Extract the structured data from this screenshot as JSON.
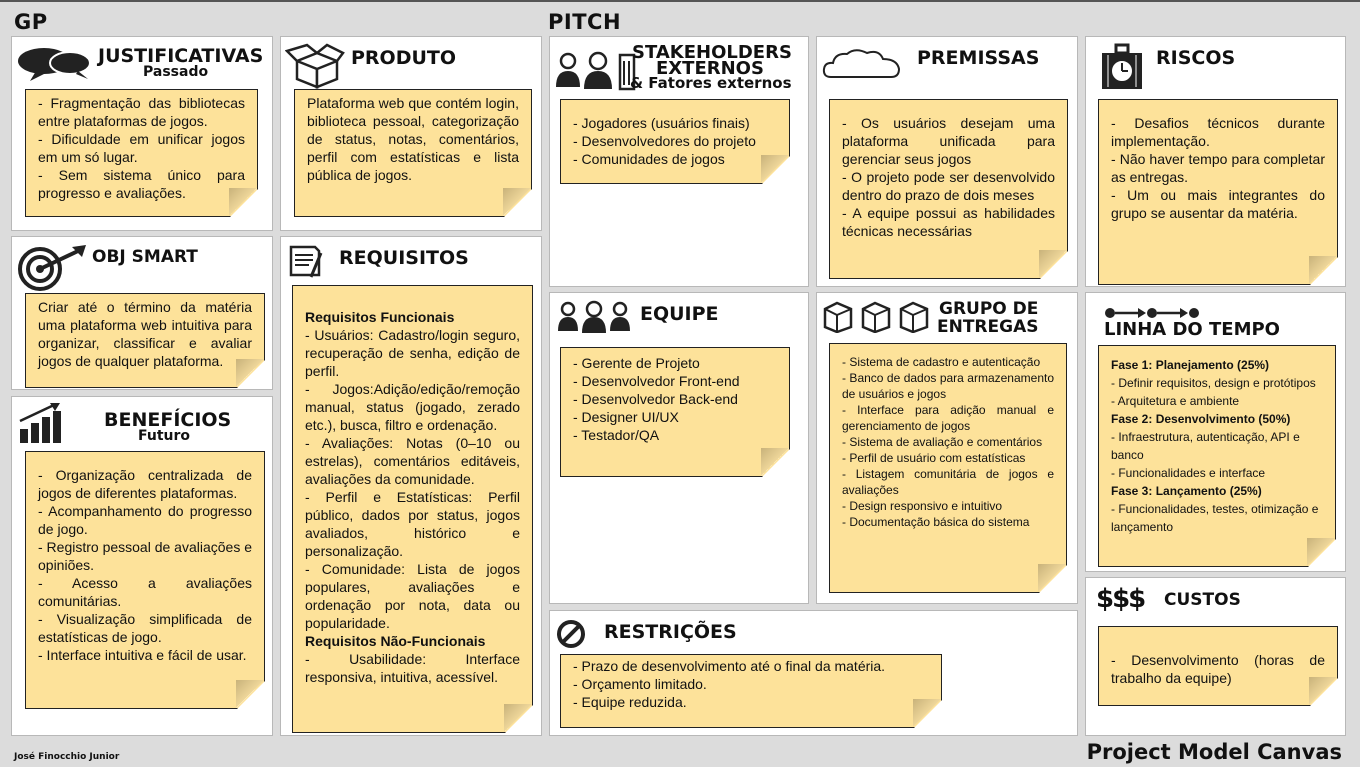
{
  "headers": {
    "gp": "GP",
    "pitch": "PITCH"
  },
  "justificativas": {
    "title": "JUSTIFICATIVAS",
    "subtitle": "Passado",
    "items": [
      "- Fragmentação das bibliotecas entre plataformas de jogos.",
      "- Dificuldade em unificar jogos em um só lugar.",
      "- Sem sistema único para progresso e avaliações."
    ]
  },
  "produto": {
    "title": "PRODUTO",
    "text": "Plataforma web que contém login, biblioteca pessoal, categorização de status, notas, comentários, perfil com estatísticas e lista pública de jogos."
  },
  "stakeholders": {
    "title1": "STAKEHOLDERS",
    "title2": "EXTERNOS",
    "title3": "& Fatores externos",
    "items": [
      "- Jogadores (usuários finais)",
      "- Desenvolvedores do projeto",
      "- Comunidades de jogos"
    ]
  },
  "premissas": {
    "title": "PREMISSAS",
    "items": [
      "- Os usuários desejam uma plataforma unificada para gerenciar seus jogos",
      "- O projeto pode ser desenvolvido dentro do prazo de dois meses",
      "- A equipe possui as habilidades técnicas necessárias"
    ]
  },
  "riscos": {
    "title": "RISCOS",
    "items": [
      "- Desafios técnicos durante implementação.",
      "- Não haver tempo para completar as entregas.",
      "- Um ou mais integrantes do grupo se ausentar da matéria."
    ]
  },
  "obj": {
    "title": "OBJ SMART",
    "text": "Criar até o término da matéria uma plataforma web intuitiva para organizar, classificar e avaliar jogos de qualquer plataforma."
  },
  "requisitos": {
    "title": "REQUISITOS",
    "funcionais_title": "Requisitos Funcionais",
    "funcionais": [
      "- Usuários: Cadastro/login seguro, recuperação de senha, edição de perfil.",
      "- Jogos:Adição/edição/remoção manual, status (jogado, zerado etc.), busca, filtro e ordenação.",
      "- Avaliações: Notas (0–10 ou estrelas), comentários editáveis, avaliações da comunidade.",
      "- Perfil e Estatísticas: Perfil público, dados por status, jogos avaliados, histórico e personalização.",
      "- Comunidade: Lista de jogos populares, avaliações e ordenação por nota, data ou popularidade."
    ],
    "nao_funcionais_title": "Requisitos Não-Funcionais",
    "nao_funcionais": [
      "- Usabilidade: Interface responsiva, intuitiva, acessível."
    ]
  },
  "equipe": {
    "title": "EQUIPE",
    "items": [
      "- Gerente de Projeto",
      "- Desenvolvedor Front-end",
      "- Desenvolvedor Back-end",
      "- Designer UI/UX",
      "- Testador/QA"
    ]
  },
  "entregas": {
    "title1": "GRUPO DE",
    "title2": "ENTREGAS",
    "items": [
      "- Sistema de cadastro e autenticação",
      "- Banco de dados para armazenamento de usuários e jogos",
      "- Interface para adição manual e gerenciamento de jogos",
      "- Sistema de avaliação e comentários",
      "- Perfil de usuário com estatísticas",
      "- Listagem comunitária de jogos e avaliações",
      "- Design responsivo e intuitivo",
      "- Documentação básica do sistema"
    ]
  },
  "linha": {
    "title": "LINHA DO TEMPO",
    "fase1": "Fase 1: Planejamento (25%)",
    "fase1_items": [
      "- Definir requisitos, design e protótipos",
      "- Arquitetura e ambiente"
    ],
    "fase2": "Fase 2: Desenvolvimento (50%)",
    "fase2_items": [
      "- Infraestrutura, autenticação, API e banco",
      "- Funcionalidades e interface"
    ],
    "fase3": "Fase 3: Lançamento (25%)",
    "fase3_items": [
      "- Funcionalidades, testes, otimização e lançamento"
    ]
  },
  "beneficios": {
    "title": "BENEFÍCIOS",
    "subtitle": "Futuro",
    "items": [
      "- Organização centralizada de jogos de diferentes plataformas.",
      "- Acompanhamento do progresso de jogo.",
      "- Registro pessoal de avaliações e opiniões.",
      "- Acesso a avaliações comunitárias.",
      "- Visualização simplificada de estatísticas de jogo.",
      "- Interface intuitiva e fácil de usar."
    ]
  },
  "restricoes": {
    "title": "RESTRIÇÕES",
    "items": [
      "- Prazo de desenvolvimento até o final da matéria.",
      "- Orçamento limitado.",
      "- Equipe reduzida."
    ]
  },
  "custos": {
    "title": "CUSTOS",
    "icon_text": "$$$",
    "items": [
      "- Desenvolvimento (horas de trabalho da equipe)"
    ]
  },
  "footer": {
    "author": "José Finocchio Junior",
    "brand": "Project Model Canvas"
  },
  "colors": {
    "note": "#fde29a",
    "background": "#dcdcdc",
    "panel": "#ffffff"
  }
}
